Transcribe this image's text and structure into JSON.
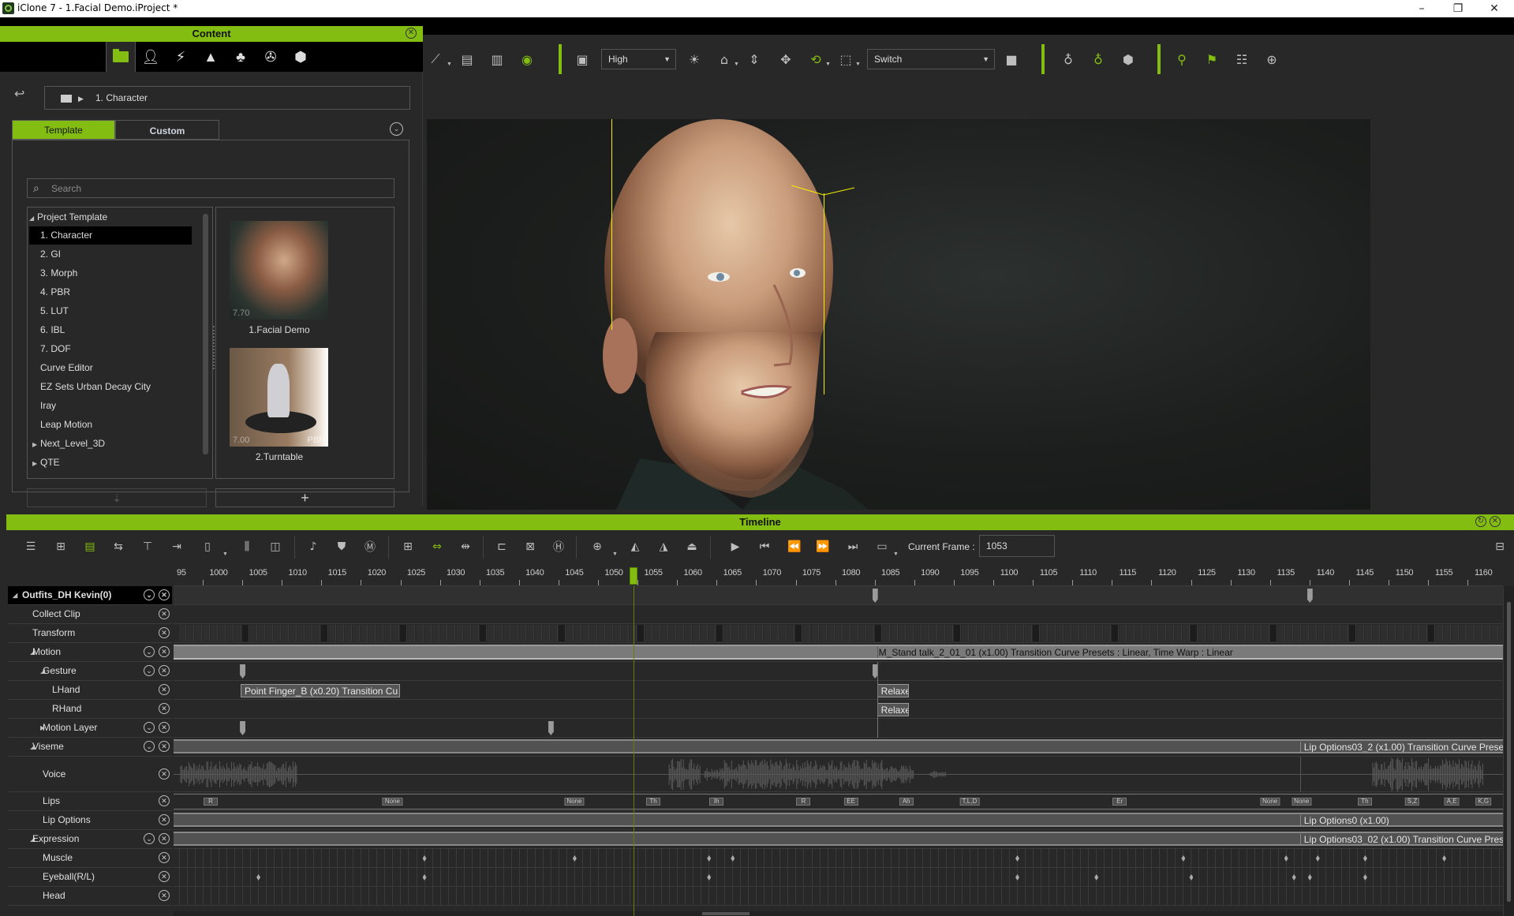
{
  "window": {
    "title": "iClone 7 - 1.Facial Demo.iProject *",
    "controls": [
      "minimize",
      "restore",
      "close"
    ]
  },
  "content_panel": {
    "title": "Content",
    "category_tabs": [
      {
        "name": "project-folder",
        "icon": "folder-icon",
        "active": true
      },
      {
        "name": "actor",
        "icon": "person-icon"
      },
      {
        "name": "animation",
        "icon": "running-icon"
      },
      {
        "name": "stage",
        "icon": "stage-icon"
      },
      {
        "name": "set",
        "icon": "tree-icon"
      },
      {
        "name": "media",
        "icon": "film-reel-icon"
      },
      {
        "name": "props",
        "icon": "box-icon"
      }
    ],
    "path": "1. Character",
    "tabs": {
      "template": "Template",
      "custom": "Custom"
    },
    "search_placeholder": "Search",
    "tree": {
      "root": "Project Template",
      "items": [
        {
          "label": "1. Character",
          "selected": true
        },
        {
          "label": "2. GI"
        },
        {
          "label": "3. Morph"
        },
        {
          "label": "4. PBR"
        },
        {
          "label": "5. LUT"
        },
        {
          "label": "6. IBL"
        },
        {
          "label": "7. DOF"
        },
        {
          "label": "Curve Editor"
        },
        {
          "label": "EZ Sets Urban Decay City"
        },
        {
          "label": "Iray"
        },
        {
          "label": "Leap Motion"
        },
        {
          "label": "Next_Level_3D",
          "collapsed": true
        },
        {
          "label": "QTE",
          "collapsed": true
        }
      ]
    },
    "thumbnails": [
      {
        "label": "1.Facial Demo",
        "version": "7.70",
        "badge": ""
      },
      {
        "label": "2.Turntable",
        "version": "7.00",
        "badge": "PBR"
      }
    ],
    "buttons": {
      "import": "⇣",
      "add": "+"
    }
  },
  "toolbar": {
    "quality_select": "High",
    "camera_select": "Switch"
  },
  "timeline": {
    "title": "Timeline",
    "current_frame_label": "Current Frame :",
    "current_frame": "1053",
    "ruler": {
      "start_label": "95",
      "ticks": [
        1000,
        1005,
        1010,
        1015,
        1020,
        1025,
        1030,
        1035,
        1040,
        1045,
        1050,
        1055,
        1060,
        1065,
        1070,
        1075,
        1080,
        1085,
        1090,
        1095,
        1100,
        1105,
        1110,
        1115,
        1120,
        1125,
        1130,
        1135,
        1140,
        1145,
        1150,
        1155,
        1160
      ]
    },
    "tracks": [
      {
        "label": "Outfits_DH Kevin(0)",
        "level": 0,
        "expanded": true,
        "has_collapse": true
      },
      {
        "label": "Collect Clip",
        "level": 1
      },
      {
        "label": "Transform",
        "level": 1
      },
      {
        "label": "Motion",
        "level": 1,
        "expanded": true,
        "has_collapse": true
      },
      {
        "label": "Gesture",
        "level": 2,
        "expanded": true,
        "has_collapse": true
      },
      {
        "label": "LHand",
        "level": 3
      },
      {
        "label": "RHand",
        "level": 3
      },
      {
        "label": "Motion Layer",
        "level": 2,
        "expanded": false,
        "has_collapse": true
      },
      {
        "label": "Viseme",
        "level": 1,
        "expanded": true,
        "has_collapse": true
      },
      {
        "label": "Voice",
        "level": 2,
        "tall": true
      },
      {
        "label": "Lips",
        "level": 2
      },
      {
        "label": "Lip Options",
        "level": 2
      },
      {
        "label": "Expression",
        "level": 1,
        "expanded": true,
        "has_collapse": true
      },
      {
        "label": "Muscle",
        "level": 2
      },
      {
        "label": "Eyeball(R/L)",
        "level": 2
      },
      {
        "label": "Head",
        "level": 2
      }
    ],
    "clips": {
      "motion": "M_Stand talk_2_01_01 (x1.00) Transition Curve Presets : Linear, Time Warp : Linear",
      "lhand_1": "Point Finger_B (x0.20) Transition Cu",
      "lhand_2": "Relaxe",
      "rhand": "Relaxe",
      "viseme": "Lip Options03_2 (x1.00) Transition Curve Prese",
      "lip_options": "Lip Options0 (x1.00)",
      "expression": "Lip Options03_02 (x1.00) Transition Curve Pres"
    },
    "visemes": [
      {
        "label": "R",
        "frame": 999
      },
      {
        "label": "None",
        "frame": 1022
      },
      {
        "label": "None",
        "frame": 1045
      },
      {
        "label": "Th",
        "frame": 1055
      },
      {
        "label": "Ih",
        "frame": 1063
      },
      {
        "label": "R",
        "frame": 1074
      },
      {
        "label": "EE",
        "frame": 1080
      },
      {
        "label": "Ah",
        "frame": 1087
      },
      {
        "label": "T,L,D",
        "frame": 1095
      },
      {
        "label": "Er",
        "frame": 1114
      },
      {
        "label": "None",
        "frame": 1133
      },
      {
        "label": "None",
        "frame": 1137
      },
      {
        "label": "Th",
        "frame": 1145
      },
      {
        "label": "S,Z",
        "frame": 1151
      },
      {
        "label": "A,E",
        "frame": 1156
      },
      {
        "label": "K,G",
        "frame": 1160
      }
    ]
  }
}
